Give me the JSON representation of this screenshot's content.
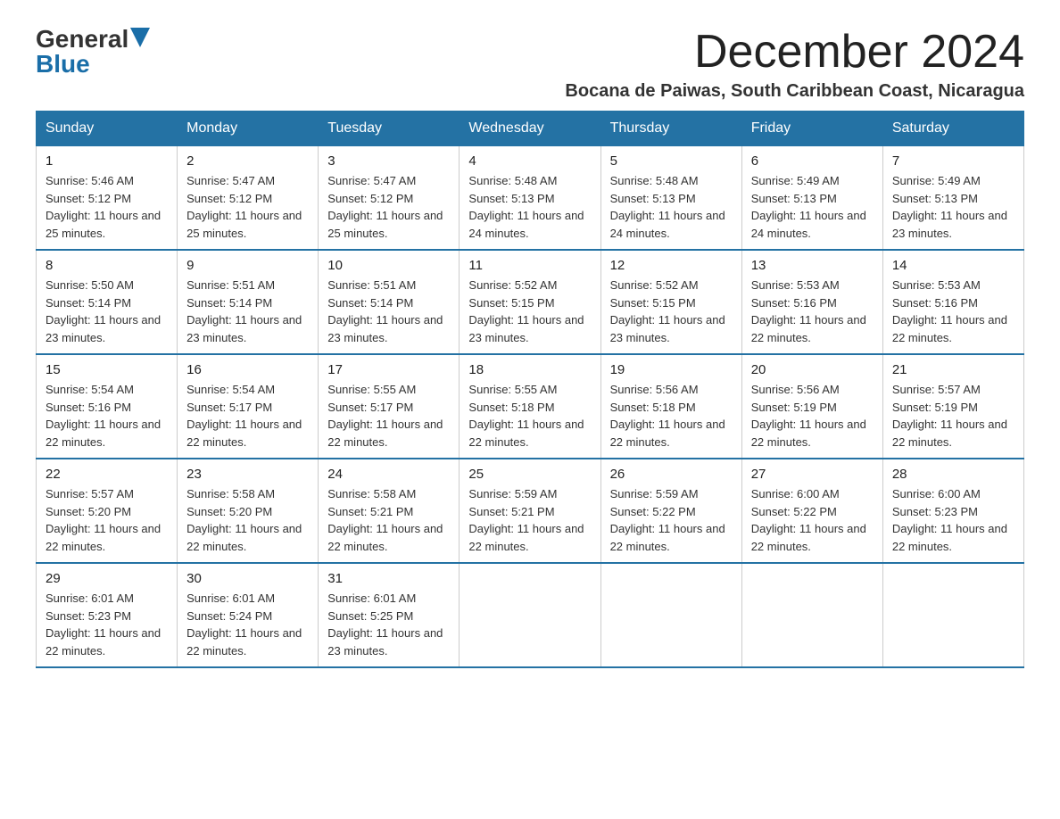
{
  "logo": {
    "general": "General",
    "blue": "Blue"
  },
  "header": {
    "month_title": "December 2024",
    "subtitle": "Bocana de Paiwas, South Caribbean Coast, Nicaragua"
  },
  "days_of_week": [
    "Sunday",
    "Monday",
    "Tuesday",
    "Wednesday",
    "Thursday",
    "Friday",
    "Saturday"
  ],
  "weeks": [
    [
      {
        "day": "1",
        "sunrise": "5:46 AM",
        "sunset": "5:12 PM",
        "daylight": "11 hours and 25 minutes."
      },
      {
        "day": "2",
        "sunrise": "5:47 AM",
        "sunset": "5:12 PM",
        "daylight": "11 hours and 25 minutes."
      },
      {
        "day": "3",
        "sunrise": "5:47 AM",
        "sunset": "5:12 PM",
        "daylight": "11 hours and 25 minutes."
      },
      {
        "day": "4",
        "sunrise": "5:48 AM",
        "sunset": "5:13 PM",
        "daylight": "11 hours and 24 minutes."
      },
      {
        "day": "5",
        "sunrise": "5:48 AM",
        "sunset": "5:13 PM",
        "daylight": "11 hours and 24 minutes."
      },
      {
        "day": "6",
        "sunrise": "5:49 AM",
        "sunset": "5:13 PM",
        "daylight": "11 hours and 24 minutes."
      },
      {
        "day": "7",
        "sunrise": "5:49 AM",
        "sunset": "5:13 PM",
        "daylight": "11 hours and 23 minutes."
      }
    ],
    [
      {
        "day": "8",
        "sunrise": "5:50 AM",
        "sunset": "5:14 PM",
        "daylight": "11 hours and 23 minutes."
      },
      {
        "day": "9",
        "sunrise": "5:51 AM",
        "sunset": "5:14 PM",
        "daylight": "11 hours and 23 minutes."
      },
      {
        "day": "10",
        "sunrise": "5:51 AM",
        "sunset": "5:14 PM",
        "daylight": "11 hours and 23 minutes."
      },
      {
        "day": "11",
        "sunrise": "5:52 AM",
        "sunset": "5:15 PM",
        "daylight": "11 hours and 23 minutes."
      },
      {
        "day": "12",
        "sunrise": "5:52 AM",
        "sunset": "5:15 PM",
        "daylight": "11 hours and 23 minutes."
      },
      {
        "day": "13",
        "sunrise": "5:53 AM",
        "sunset": "5:16 PM",
        "daylight": "11 hours and 22 minutes."
      },
      {
        "day": "14",
        "sunrise": "5:53 AM",
        "sunset": "5:16 PM",
        "daylight": "11 hours and 22 minutes."
      }
    ],
    [
      {
        "day": "15",
        "sunrise": "5:54 AM",
        "sunset": "5:16 PM",
        "daylight": "11 hours and 22 minutes."
      },
      {
        "day": "16",
        "sunrise": "5:54 AM",
        "sunset": "5:17 PM",
        "daylight": "11 hours and 22 minutes."
      },
      {
        "day": "17",
        "sunrise": "5:55 AM",
        "sunset": "5:17 PM",
        "daylight": "11 hours and 22 minutes."
      },
      {
        "day": "18",
        "sunrise": "5:55 AM",
        "sunset": "5:18 PM",
        "daylight": "11 hours and 22 minutes."
      },
      {
        "day": "19",
        "sunrise": "5:56 AM",
        "sunset": "5:18 PM",
        "daylight": "11 hours and 22 minutes."
      },
      {
        "day": "20",
        "sunrise": "5:56 AM",
        "sunset": "5:19 PM",
        "daylight": "11 hours and 22 minutes."
      },
      {
        "day": "21",
        "sunrise": "5:57 AM",
        "sunset": "5:19 PM",
        "daylight": "11 hours and 22 minutes."
      }
    ],
    [
      {
        "day": "22",
        "sunrise": "5:57 AM",
        "sunset": "5:20 PM",
        "daylight": "11 hours and 22 minutes."
      },
      {
        "day": "23",
        "sunrise": "5:58 AM",
        "sunset": "5:20 PM",
        "daylight": "11 hours and 22 minutes."
      },
      {
        "day": "24",
        "sunrise": "5:58 AM",
        "sunset": "5:21 PM",
        "daylight": "11 hours and 22 minutes."
      },
      {
        "day": "25",
        "sunrise": "5:59 AM",
        "sunset": "5:21 PM",
        "daylight": "11 hours and 22 minutes."
      },
      {
        "day": "26",
        "sunrise": "5:59 AM",
        "sunset": "5:22 PM",
        "daylight": "11 hours and 22 minutes."
      },
      {
        "day": "27",
        "sunrise": "6:00 AM",
        "sunset": "5:22 PM",
        "daylight": "11 hours and 22 minutes."
      },
      {
        "day": "28",
        "sunrise": "6:00 AM",
        "sunset": "5:23 PM",
        "daylight": "11 hours and 22 minutes."
      }
    ],
    [
      {
        "day": "29",
        "sunrise": "6:01 AM",
        "sunset": "5:23 PM",
        "daylight": "11 hours and 22 minutes."
      },
      {
        "day": "30",
        "sunrise": "6:01 AM",
        "sunset": "5:24 PM",
        "daylight": "11 hours and 22 minutes."
      },
      {
        "day": "31",
        "sunrise": "6:01 AM",
        "sunset": "5:25 PM",
        "daylight": "11 hours and 23 minutes."
      },
      null,
      null,
      null,
      null
    ]
  ]
}
